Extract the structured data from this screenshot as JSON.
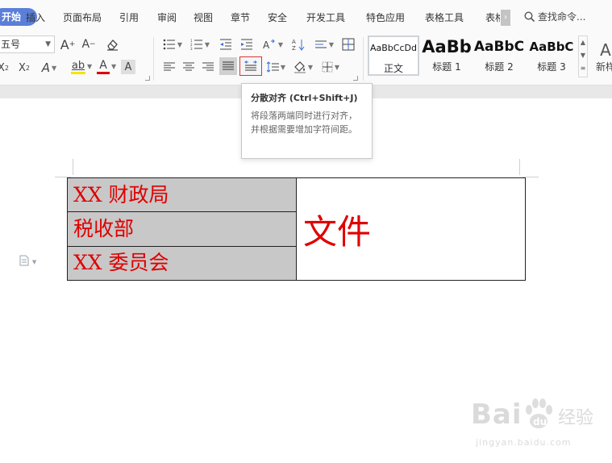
{
  "menu": {
    "active": "开始",
    "items": [
      "插入",
      "页面布局",
      "引用",
      "审阅",
      "视图",
      "章节",
      "安全",
      "开发工具",
      "特色应用",
      "表格工具",
      "表格"
    ],
    "more": "›",
    "search": "查找命令..."
  },
  "toolbar": {
    "font_size": "五号",
    "btn_grow": "A",
    "btn_shrink": "A",
    "btn_superscript": "X",
    "btn_subscript": "X",
    "btn_text_effect": "A",
    "btn_highlight": "ab",
    "btn_font_color": "A",
    "btn_char_shade": "A",
    "highlight_color": "#f5e400",
    "font_color": "#e00000"
  },
  "styles": [
    {
      "preview": "AaBbCcDd",
      "label": "正文"
    },
    {
      "preview": "AaBb",
      "label": "标题 1"
    },
    {
      "preview": "AaBbC",
      "label": "标题 2"
    },
    {
      "preview": "AaBbC",
      "label": "标题 3"
    }
  ],
  "new_style": {
    "icon": "A",
    "label": "新样"
  },
  "tooltip": {
    "title": "分散对齐 (Ctrl+Shift+J)",
    "body": "将段落两端同时进行对齐，并根据需要增加字符间距。"
  },
  "document": {
    "table": {
      "rows": [
        "XX 财政局",
        "税收部",
        "XX 委员会"
      ],
      "merged_cell": "文件"
    }
  },
  "watermark": {
    "logo": "Bai",
    "cn": "经验",
    "url": "jingyan.baidu.com"
  },
  "colors": {
    "accent": "#5b7fd8",
    "doc_red": "#e00000",
    "cell_gray": "#c8c8c8"
  }
}
